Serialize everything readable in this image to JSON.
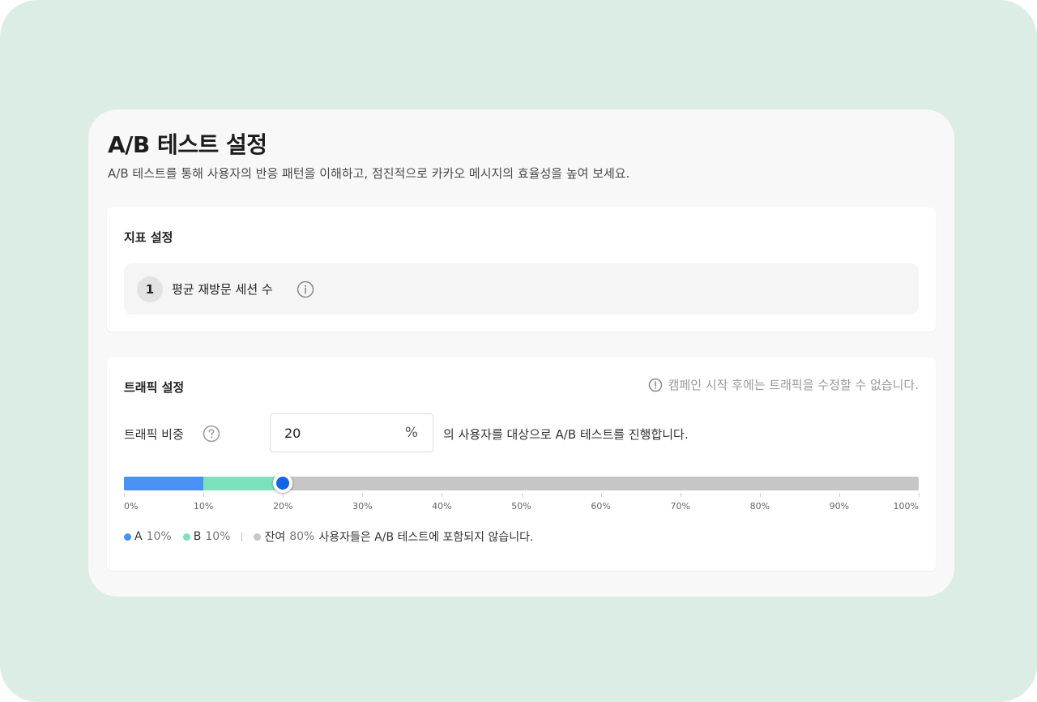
{
  "header": {
    "title": "A/B 테스트 설정",
    "subtitle": "A/B 테스트를 통해 사용자의 반응 패턴을 이해하고, 점진적으로 카카오 메시지의 효율성을 높여 보세요."
  },
  "metric_section": {
    "title": "지표 설정",
    "items": [
      {
        "number": "1",
        "label": "평균 재방문 세션 수"
      }
    ]
  },
  "traffic_section": {
    "title": "트래픽 설정",
    "notice": "캠페인 시작 후에는 트래픽을 수정할 수 없습니다.",
    "ratio_label": "트래픽 비중",
    "ratio_value": "20",
    "ratio_unit": "%",
    "ratio_description": "의 사용자를 대상으로 A/B 테스트를 진행합니다.",
    "slider": {
      "a_percent": 10,
      "b_percent": 10,
      "value_percent": 20,
      "ticks": [
        "0%",
        "10%",
        "20%",
        "30%",
        "40%",
        "50%",
        "60%",
        "70%",
        "80%",
        "90%",
        "100%"
      ]
    },
    "legend": {
      "a_label": "A",
      "a_value": "10%",
      "b_label": "B",
      "b_value": "10%",
      "rest_label": "잔여",
      "rest_value": "80%",
      "rest_note": "사용자들은 A/B 테스트에 포함되지 않습니다."
    }
  },
  "colors": {
    "background": "#dcede6",
    "panel": "#f8f8f8",
    "segment_a": "#4a90f5",
    "segment_b": "#7be3bb",
    "segment_rest": "#c6c6c6",
    "thumb": "#1464e6"
  },
  "icons": {
    "metric_info": "info-circle-icon",
    "notice": "alert-circle-icon",
    "ratio_help": "question-circle-icon"
  }
}
